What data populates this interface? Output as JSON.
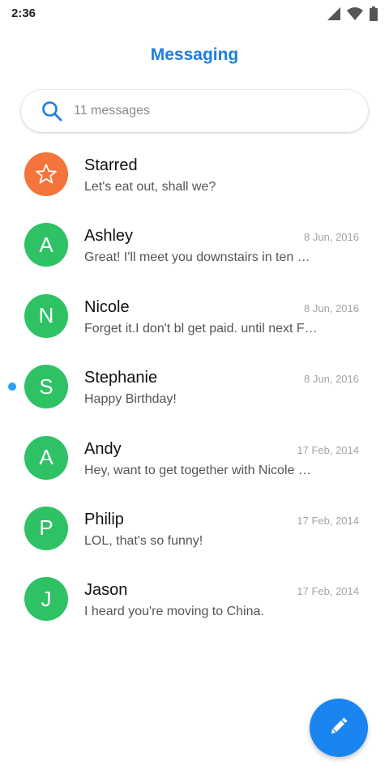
{
  "status_bar": {
    "time": "2:36",
    "icons": [
      "signal-icon",
      "wifi-icon",
      "battery-icon"
    ]
  },
  "app": {
    "title": "Messaging"
  },
  "search": {
    "placeholder": "11 messages",
    "icon": "search-icon"
  },
  "colors": {
    "accent": "#1a7fe3",
    "avatar_green": "#2ec265",
    "avatar_orange": "#f4743b",
    "unread_dot": "#2aa0f0",
    "fab": "#1a84f0"
  },
  "conversations": [
    {
      "name": "Starred",
      "preview": "Let's eat out, shall we?",
      "date": "",
      "avatar_icon": "star-icon",
      "avatar_letter": "",
      "avatar_color": "#f4743b",
      "unread": false
    },
    {
      "name": "Ashley",
      "preview": "Great! I'll meet you downstairs in ten …",
      "date": "8 Jun, 2016",
      "avatar_letter": "A",
      "avatar_color": "#2ec265",
      "unread": false
    },
    {
      "name": "Nicole",
      "preview": "Forget it.I don't bl get paid. until next F…",
      "date": "8 Jun, 2016",
      "avatar_letter": "N",
      "avatar_color": "#2ec265",
      "unread": false
    },
    {
      "name": "Stephanie",
      "preview": "Happy Birthday!",
      "date": "8 Jun, 2016",
      "avatar_letter": "S",
      "avatar_color": "#2ec265",
      "unread": true
    },
    {
      "name": "Andy",
      "preview": "Hey, want to get together with Nicole …",
      "date": "17 Feb, 2014",
      "avatar_letter": "A",
      "avatar_color": "#2ec265",
      "unread": false
    },
    {
      "name": "Philip",
      "preview": "LOL, that's so funny!",
      "date": "17 Feb, 2014",
      "avatar_letter": "P",
      "avatar_color": "#2ec265",
      "unread": false
    },
    {
      "name": "Jason",
      "preview": "I heard you're moving to China.",
      "date": "17 Feb, 2014",
      "avatar_letter": "J",
      "avatar_color": "#2ec265",
      "unread": false
    }
  ],
  "fab": {
    "icon": "pencil-icon"
  }
}
